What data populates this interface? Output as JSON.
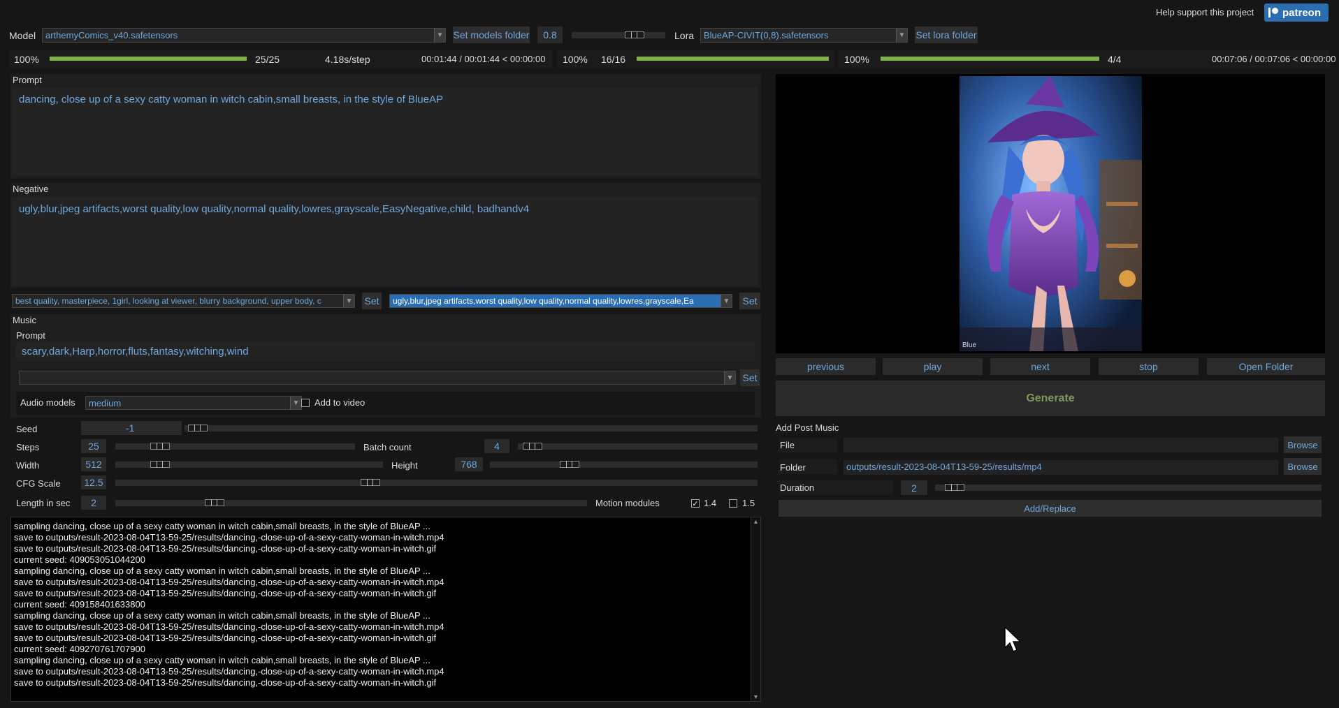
{
  "header": {
    "support_text": "Help support this project",
    "patreon_label": "patreon"
  },
  "model_row": {
    "model_label": "Model",
    "model_value": "arthemyComics_v40.safetensors",
    "set_models_folder": "Set models folder",
    "lora_weight": "0.8",
    "lora_weight_fraction": 0.72,
    "lora_label": "Lora",
    "lora_value": "BlueAP-CIVIT(0,8).safetensors",
    "set_lora_folder": "Set lora folder"
  },
  "progress": {
    "p1_pct": "100%",
    "p1_fraction": 1.0,
    "p1_steps": "25/25",
    "p1_rate": "4.18s/step",
    "p1_time": "00:01:44 / 00:01:44 < 00:00:00",
    "p2_pct": "100%",
    "p2_steps": "16/16",
    "p2_fraction": 1.0,
    "p3_pct": "100%",
    "p3_fraction": 1.0,
    "p3_steps": "4/4",
    "p3_time": "00:07:06 / 00:07:06 < 00:00:00"
  },
  "prompt": {
    "label": "Prompt",
    "value": "dancing, close up of a sexy catty woman in witch cabin,small breasts, in the style of BlueAP"
  },
  "negative": {
    "label": "Negative",
    "value": "ugly,blur,jpeg artifacts,worst quality,low quality,normal quality,lowres,grayscale,EasyNegative,child, badhandv4"
  },
  "presets": {
    "positive_value": "best quality, masterpiece, 1girl, looking at viewer, blurry background, upper body, c",
    "positive_set": "Set",
    "negative_value": "ugly,blur,jpeg artifacts,worst quality,low quality,normal quality,lowres,grayscale,Ea",
    "negative_set": "Set"
  },
  "music": {
    "section_label": "Music",
    "prompt_label": "Prompt",
    "prompt_value": "scary,dark,Harp,horror,fluts,fantasy,witching,wind",
    "preset_value": "",
    "preset_set": "Set",
    "audio_models_label": "Audio models",
    "audio_model_value": "medium",
    "add_to_video_label": "Add to video"
  },
  "params": {
    "seed_label": "Seed",
    "seed_value": "-1",
    "steps_label": "Steps",
    "steps_value": "25",
    "batch_label": "Batch count",
    "batch_value": "4",
    "width_label": "Width",
    "width_value": "512",
    "height_label": "Height",
    "height_value": "768",
    "cfg_label": "CFG Scale",
    "cfg_value": "12.5",
    "length_label": "Length in sec",
    "length_value": "2",
    "motion_label": "Motion modules",
    "motion_14_label": "1.4",
    "motion_14_checked": true,
    "motion_15_label": "1.5",
    "motion_15_checked": false
  },
  "log": [
    "sampling dancing, close up of a sexy catty woman in witch cabin,small breasts, in the style of BlueAP ...",
    "save to outputs/result-2023-08-04T13-59-25/results/dancing,-close-up-of-a-sexy-catty-woman-in-witch.mp4",
    "save to outputs/result-2023-08-04T13-59-25/results/dancing,-close-up-of-a-sexy-catty-woman-in-witch.gif",
    "current seed: 409053051044200",
    "sampling dancing, close up of a sexy catty woman in witch cabin,small breasts, in the style of BlueAP ...",
    "save to outputs/result-2023-08-04T13-59-25/results/dancing,-close-up-of-a-sexy-catty-woman-in-witch.mp4",
    "save to outputs/result-2023-08-04T13-59-25/results/dancing,-close-up-of-a-sexy-catty-woman-in-witch.gif",
    "current seed: 409158401633800",
    "sampling dancing, close up of a sexy catty woman in witch cabin,small breasts, in the style of BlueAP ...",
    "save to outputs/result-2023-08-04T13-59-25/results/dancing,-close-up-of-a-sexy-catty-woman-in-witch.mp4",
    "save to outputs/result-2023-08-04T13-59-25/results/dancing,-close-up-of-a-sexy-catty-woman-in-witch.gif",
    "current seed: 409270761707900",
    "sampling dancing, close up of a sexy catty woman in witch cabin,small breasts, in the style of BlueAP ...",
    "save to outputs/result-2023-08-04T13-59-25/results/dancing,-close-up-of-a-sexy-catty-woman-in-witch.mp4",
    "save to outputs/result-2023-08-04T13-59-25/results/dancing,-close-up-of-a-sexy-catty-woman-in-witch.gif"
  ],
  "preview": {
    "watermark": "Blue"
  },
  "playback": {
    "previous": "previous",
    "play": "play",
    "next": "next",
    "stop": "stop",
    "open_folder": "Open Folder"
  },
  "generate_label": "Generate",
  "post_music": {
    "section_label": "Add Post Music",
    "file_label": "File",
    "file_value": "",
    "browse1": "Browse",
    "folder_label": "Folder",
    "folder_value": "outputs/result-2023-08-04T13-59-25/results/mp4",
    "browse2": "Browse",
    "duration_label": "Duration",
    "duration_value": "2",
    "add_replace": "Add/Replace"
  },
  "colors": {
    "accent_text": "#6fa8dc",
    "progress_fill": "#7cb342",
    "generate_text": "#7e9a5a",
    "patreon": "#2a6db0"
  }
}
